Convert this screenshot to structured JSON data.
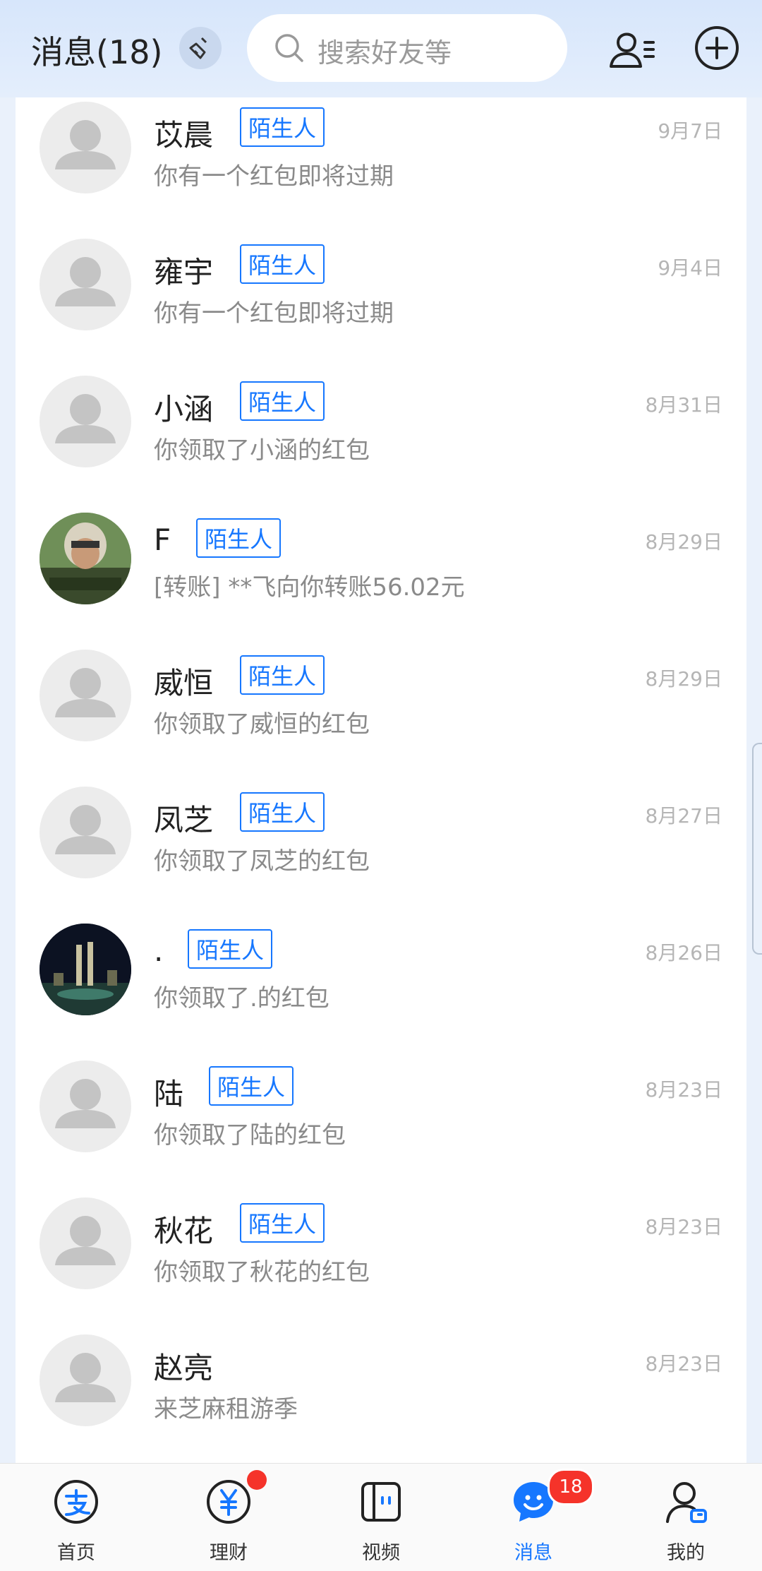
{
  "header": {
    "title": "消息(18)",
    "search_placeholder": "搜索好友等"
  },
  "messages": [
    {
      "name": "苡晨",
      "tag": "陌生人",
      "preview": "你有一个红包即将过期",
      "time": "9月7日",
      "avatar": "default"
    },
    {
      "name": "雍宇",
      "tag": "陌生人",
      "preview": "你有一个红包即将过期",
      "time": "9月4日",
      "avatar": "default"
    },
    {
      "name": "小涵",
      "tag": "陌生人",
      "preview": "你领取了小涵的红包",
      "time": "8月31日",
      "avatar": "default"
    },
    {
      "name": "F",
      "tag": "陌生人",
      "preview": "[转账] **飞向你转账56.02元",
      "time": "8月29日",
      "avatar": "photo-pilot"
    },
    {
      "name": "威恒",
      "tag": "陌生人",
      "preview": "你领取了威恒的红包",
      "time": "8月29日",
      "avatar": "default"
    },
    {
      "name": "凤芝",
      "tag": "陌生人",
      "preview": "你领取了凤芝的红包",
      "time": "8月27日",
      "avatar": "default"
    },
    {
      "name": ".",
      "tag": "陌生人",
      "preview": "你领取了.的红包",
      "time": "8月26日",
      "avatar": "photo-night-city"
    },
    {
      "name": "陆",
      "tag": "陌生人",
      "preview": "你领取了陆的红包",
      "time": "8月23日",
      "avatar": "default"
    },
    {
      "name": "秋花",
      "tag": "陌生人",
      "preview": "你领取了秋花的红包",
      "time": "8月23日",
      "avatar": "default"
    },
    {
      "name": "赵亮",
      "tag": "",
      "preview": "来芝麻租游季",
      "time": "8月23日",
      "avatar": "default"
    }
  ],
  "tabs": [
    {
      "label": "首页",
      "icon": "alipay-home-icon"
    },
    {
      "label": "理财",
      "icon": "wealth-icon"
    },
    {
      "label": "视频",
      "icon": "video-icon"
    },
    {
      "label": "消息",
      "icon": "message-icon",
      "active": true
    },
    {
      "label": "我的",
      "icon": "profile-icon"
    }
  ],
  "badges": {
    "messages_count": "18"
  },
  "colors": {
    "accent": "#1677ff",
    "badge": "#f5332a",
    "header_bg": "#d7e6fb"
  }
}
